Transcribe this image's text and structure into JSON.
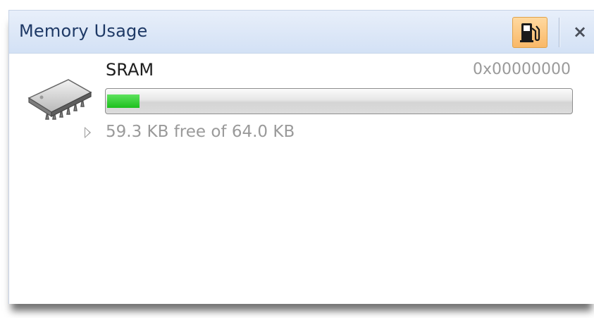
{
  "panel": {
    "title": "Memory Usage",
    "toolbar": {
      "fuel_icon": "fuel-pump-icon",
      "close_label": "×"
    }
  },
  "memory": {
    "name": "SRAM",
    "address": "0x00000000",
    "chip_icon": "memory-chip-icon",
    "used_fraction": 0.073,
    "free_text": "59.3 KB free of 64.0 KB",
    "expander_icon": "expand-triangle-icon",
    "bar_color": "#22c322"
  }
}
